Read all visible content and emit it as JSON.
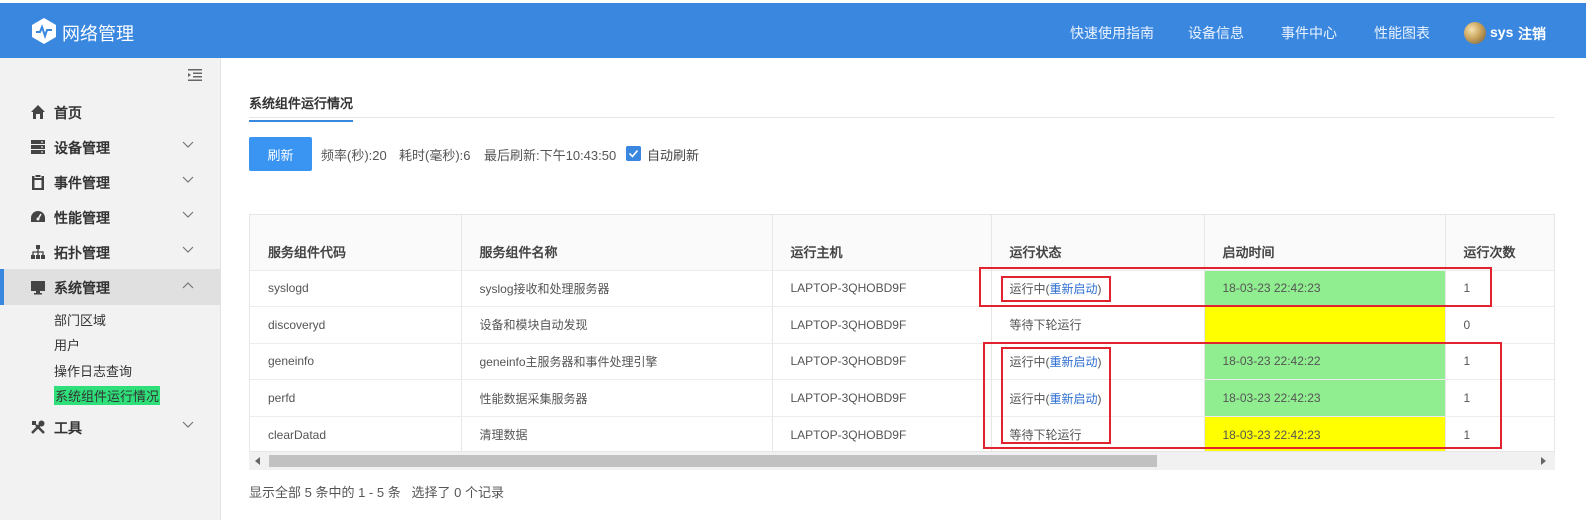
{
  "header": {
    "app_title": "网络管理",
    "nav": [
      "快速使用指南",
      "设备信息",
      "事件中心",
      "性能图表"
    ],
    "user": "sys",
    "logout": "注销",
    "color": "#3a87e0"
  },
  "sidebar": {
    "items": [
      {
        "label": "首页",
        "icon": "home-icon"
      },
      {
        "label": "设备管理",
        "icon": "server-icon"
      },
      {
        "label": "事件管理",
        "icon": "clipboard-icon"
      },
      {
        "label": "性能管理",
        "icon": "dashboard-icon"
      },
      {
        "label": "拓扑管理",
        "icon": "sitemap-icon"
      },
      {
        "label": "系统管理",
        "icon": "monitor-icon"
      },
      {
        "label": "工具",
        "icon": "tools-icon"
      }
    ],
    "sub_items": [
      "部门区域",
      "用户",
      "操作日志查询",
      "系统组件运行情况"
    ]
  },
  "main": {
    "tab": "系统组件运行情况",
    "refresh_label": "刷新",
    "frequency": "频率(秒):20",
    "elapsed": "耗时(毫秒):6",
    "last_refresh": "最后刷新:下午10:43:50",
    "auto_refresh_label": "自动刷新",
    "auto_refresh_checked": true
  },
  "table": {
    "columns": [
      "服务组件代码",
      "服务组件名称",
      "运行主机",
      "运行状态",
      "启动时间",
      "运行次数"
    ],
    "rows": [
      {
        "code": "syslogd",
        "name": "syslog接收和处理服务器",
        "host": "LAPTOP-3QHOBD9F",
        "status": "运行中",
        "restart": "重新启动",
        "start_time": "18-03-23 22:42:23",
        "count": "1",
        "status_color": "#90ee90"
      },
      {
        "code": "discoveryd",
        "name": "设备和模块自动发现",
        "host": "LAPTOP-3QHOBD9F",
        "status": "等待下轮运行",
        "restart": "",
        "start_time": "",
        "count": "0",
        "status_color": "#ffff00"
      },
      {
        "code": "geneinfo",
        "name": "geneinfo主服务器和事件处理引擎",
        "host": "LAPTOP-3QHOBD9F",
        "status": "运行中",
        "restart": "重新启动",
        "start_time": "18-03-23 22:42:22",
        "count": "1",
        "status_color": "#90ee90"
      },
      {
        "code": "perfd",
        "name": "性能数据采集服务器",
        "host": "LAPTOP-3QHOBD9F",
        "status": "运行中",
        "restart": "重新启动",
        "start_time": "18-03-23 22:42:23",
        "count": "1",
        "status_color": "#90ee90"
      },
      {
        "code": "clearDatad",
        "name": "清理数据",
        "host": "LAPTOP-3QHOBD9F",
        "status": "等待下轮运行",
        "restart": "",
        "start_time": "18-03-23 22:42:23",
        "count": "1",
        "status_color": "#ffff00"
      }
    ]
  },
  "footer": {
    "summary": "显示全部 5 条中的 1 - 5 条",
    "selected": "选择了 0 个记录"
  }
}
